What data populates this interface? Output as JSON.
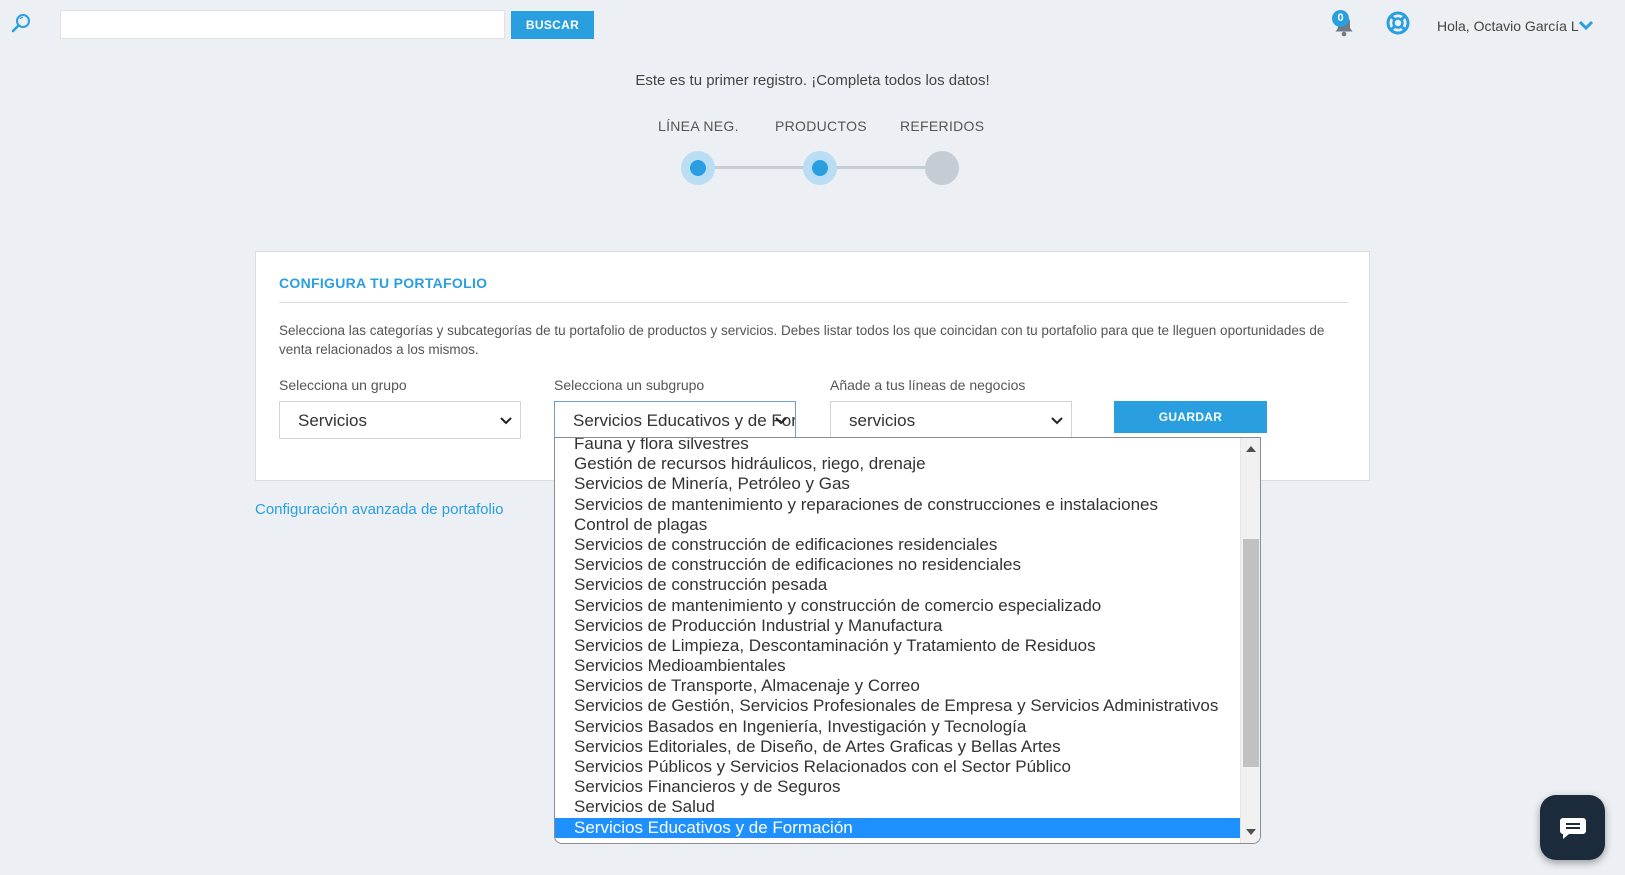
{
  "header": {
    "search_placeholder": "",
    "search_button": "BUSCAR",
    "notification_count": "0",
    "greeting": "Hola, Octavio García L"
  },
  "wizard": {
    "intro": "Este es tu primer registro. ¡Completa todos los datos!",
    "steps": [
      {
        "label": "LÍNEA NEG.",
        "status": "done"
      },
      {
        "label": "PRODUCTOS",
        "status": "done"
      },
      {
        "label": "REFERIDOS",
        "status": "pending"
      }
    ]
  },
  "portfolio": {
    "title": "CONFIGURA TU PORTAFOLIO",
    "description": "Selecciona las categorías y subcategorías de tu portafolio de productos y servicios. Debes listar todos los que coincidan con tu portafolio para que te lleguen oportunidades de venta relacionados a los mismos.",
    "group_label": "Selecciona un grupo",
    "group_value": "Servicios",
    "subgroup_label": "Selecciona un subgrupo",
    "subgroup_value": "Servicios Educativos y de Formación",
    "lines_label": "Añade a tus líneas de negocios",
    "lines_value": "servicios",
    "save_button": "GUARDAR"
  },
  "advanced_link": "Configuración avanzada de portafolio",
  "subgroup_options": [
    "Fauna y flora silvestres",
    "Gestión de recursos hidráulicos, riego, drenaje",
    "Servicios de Minería, Petróleo y Gas",
    "Servicios de mantenimiento y reparaciones de construcciones e instalaciones",
    "Control de plagas",
    "Servicios de construcción de edificaciones residenciales",
    "Servicios de construcción de edificaciones no residenciales",
    "Servicios de construcción pesada",
    "Servicios de mantenimiento y construcción de comercio especializado",
    "Servicios de Producción Industrial y Manufactura",
    "Servicios de Limpieza, Descontaminación y Tratamiento de Residuos",
    "Servicios Medioambientales",
    "Servicios de Transporte, Almacenaje y Correo",
    "Servicios de Gestión, Servicios Profesionales de Empresa y Servicios Administrativos",
    "Servicios Basados en Ingeniería, Investigación y Tecnología",
    "Servicios Editoriales, de Diseño, de Artes Graficas y Bellas Artes",
    "Servicios Públicos y Servicios Relacionados con el Sector Público",
    "Servicios Financieros y de Seguros",
    "Servicios de Salud",
    "Servicios Educativos y de Formación"
  ],
  "selected_option_index": 19,
  "colors": {
    "accent": "#2a9fe0",
    "background": "#eceff3",
    "selection": "#1e90ff",
    "chat": "#1c2b3c"
  },
  "icons": [
    "search-icon",
    "bell-icon",
    "lifebuoy-icon",
    "chevron-down-icon",
    "chat-icon"
  ]
}
